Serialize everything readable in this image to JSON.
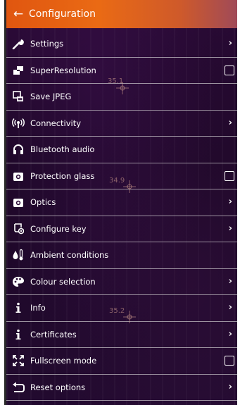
{
  "header": {
    "title": "Configuration",
    "back_icon": "arrow-left-icon"
  },
  "menu": {
    "items": [
      {
        "label": "Settings",
        "icon": "wrench-icon",
        "control": "chevron"
      },
      {
        "label": "SuperResolution",
        "icon": "superresolution-icon",
        "control": "checkbox",
        "checked": false
      },
      {
        "label": "Save JPEG",
        "icon": "jpeg-save-icon",
        "control": "none"
      },
      {
        "label": "Connectivity",
        "icon": "wireless-icon",
        "control": "chevron"
      },
      {
        "label": "Bluetooth audio",
        "icon": "headphones-icon",
        "control": "none"
      },
      {
        "label": "Protection glass",
        "icon": "camera-icon",
        "control": "checkbox",
        "checked": false
      },
      {
        "label": "Optics",
        "icon": "camera-lens-icon",
        "control": "chevron"
      },
      {
        "label": "Configure key",
        "icon": "configure-key-icon",
        "control": "chevron"
      },
      {
        "label": "Ambient conditions",
        "icon": "drop-thermometer-icon",
        "control": "none"
      },
      {
        "label": "Colour selection",
        "icon": "palette-icon",
        "control": "chevron"
      },
      {
        "label": "Info",
        "icon": "info-icon",
        "control": "chevron"
      },
      {
        "label": "Certificates",
        "icon": "info-icon",
        "control": "chevron"
      },
      {
        "label": "Fullscreen mode",
        "icon": "fullscreen-icon",
        "control": "checkbox",
        "checked": false
      },
      {
        "label": "Reset options",
        "icon": "reset-icon",
        "control": "chevron"
      }
    ]
  },
  "overlay": {
    "temperatures": [
      "35.1",
      "34.9",
      "35.2"
    ]
  },
  "colors": {
    "header_orange": "#e86214",
    "background": "#220a2f"
  }
}
